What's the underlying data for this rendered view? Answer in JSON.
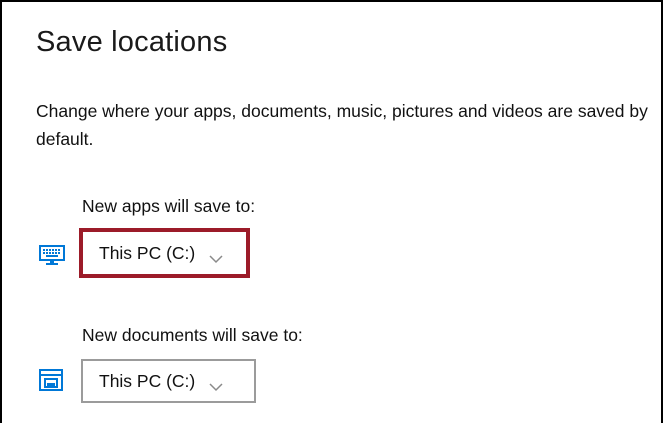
{
  "page": {
    "title": "Save locations",
    "description": "Change where your apps, documents, music, pictures and videos are saved by default."
  },
  "settings": [
    {
      "label": "New apps will save to:",
      "icon": "monitor-icon",
      "selected_value": "This PC (C:)",
      "highlighted": true
    },
    {
      "label": "New documents will save to:",
      "icon": "documents-drive-icon",
      "selected_value": "This PC (C:)",
      "highlighted": false
    }
  ],
  "colors": {
    "icon_accent": "#0078d7",
    "highlight_border": "#9c1b29",
    "dropdown_border": "#9b9b9b"
  }
}
